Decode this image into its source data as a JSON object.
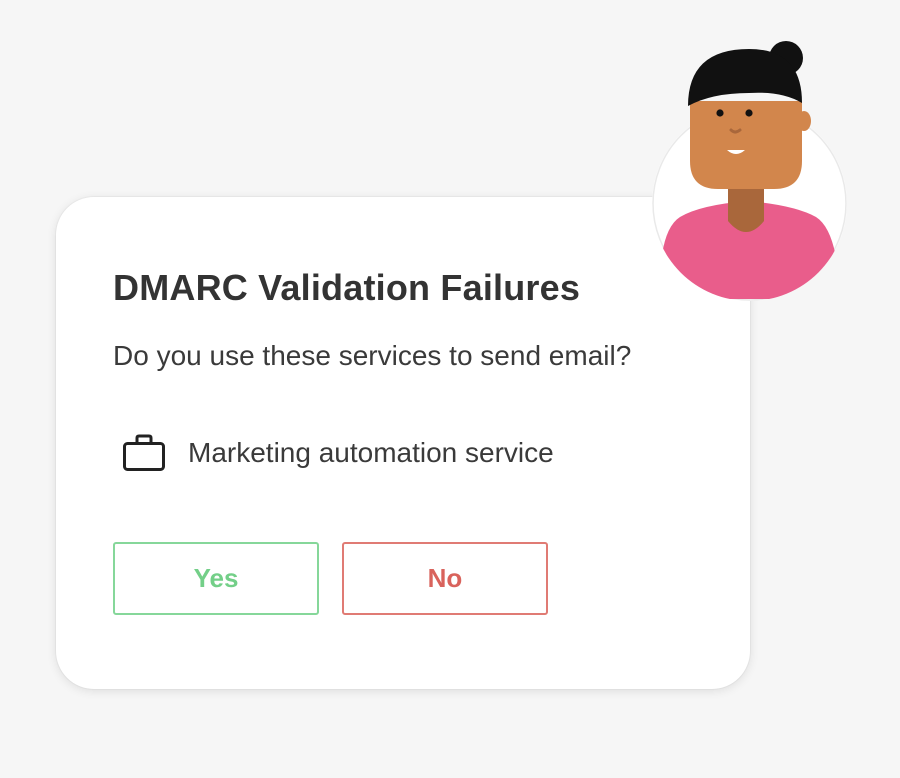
{
  "dialog": {
    "title": "DMARC Validation Failures",
    "question": "Do you use these services to send email?",
    "services": [
      {
        "icon": "briefcase-icon",
        "label": "Marketing automation service"
      }
    ],
    "yes_label": "Yes",
    "no_label": "No"
  },
  "colors": {
    "background": "#f6f6f6",
    "card": "#ffffff",
    "text": "#333333",
    "yes": "#73cf88",
    "no": "#d9635c",
    "avatar_shirt": "#e95d8b",
    "avatar_skin": "#d2864c",
    "avatar_hair": "#111111"
  },
  "avatar": {
    "icon": "person-avatar-illustration"
  }
}
